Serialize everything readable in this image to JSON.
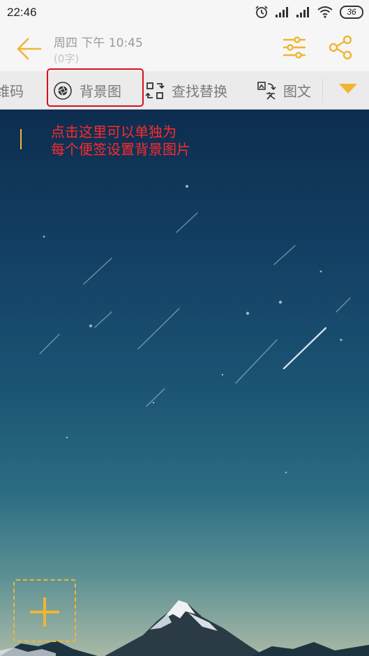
{
  "status": {
    "time": "22:46",
    "battery": "36"
  },
  "header": {
    "date": "周四 下午 10:45",
    "char_count": "(0字)"
  },
  "toolbar": {
    "prev_label": "维码",
    "background_label": "背景图",
    "find_replace_label": "查找替换",
    "image_text_label": "图文"
  },
  "annotation": {
    "line1": "点击这里可以单独为",
    "line2": "每个便签设置背景图片"
  },
  "colors": {
    "accent": "#f1b532",
    "annotation": "#ff2a2a",
    "highlight": "#d9101b"
  }
}
